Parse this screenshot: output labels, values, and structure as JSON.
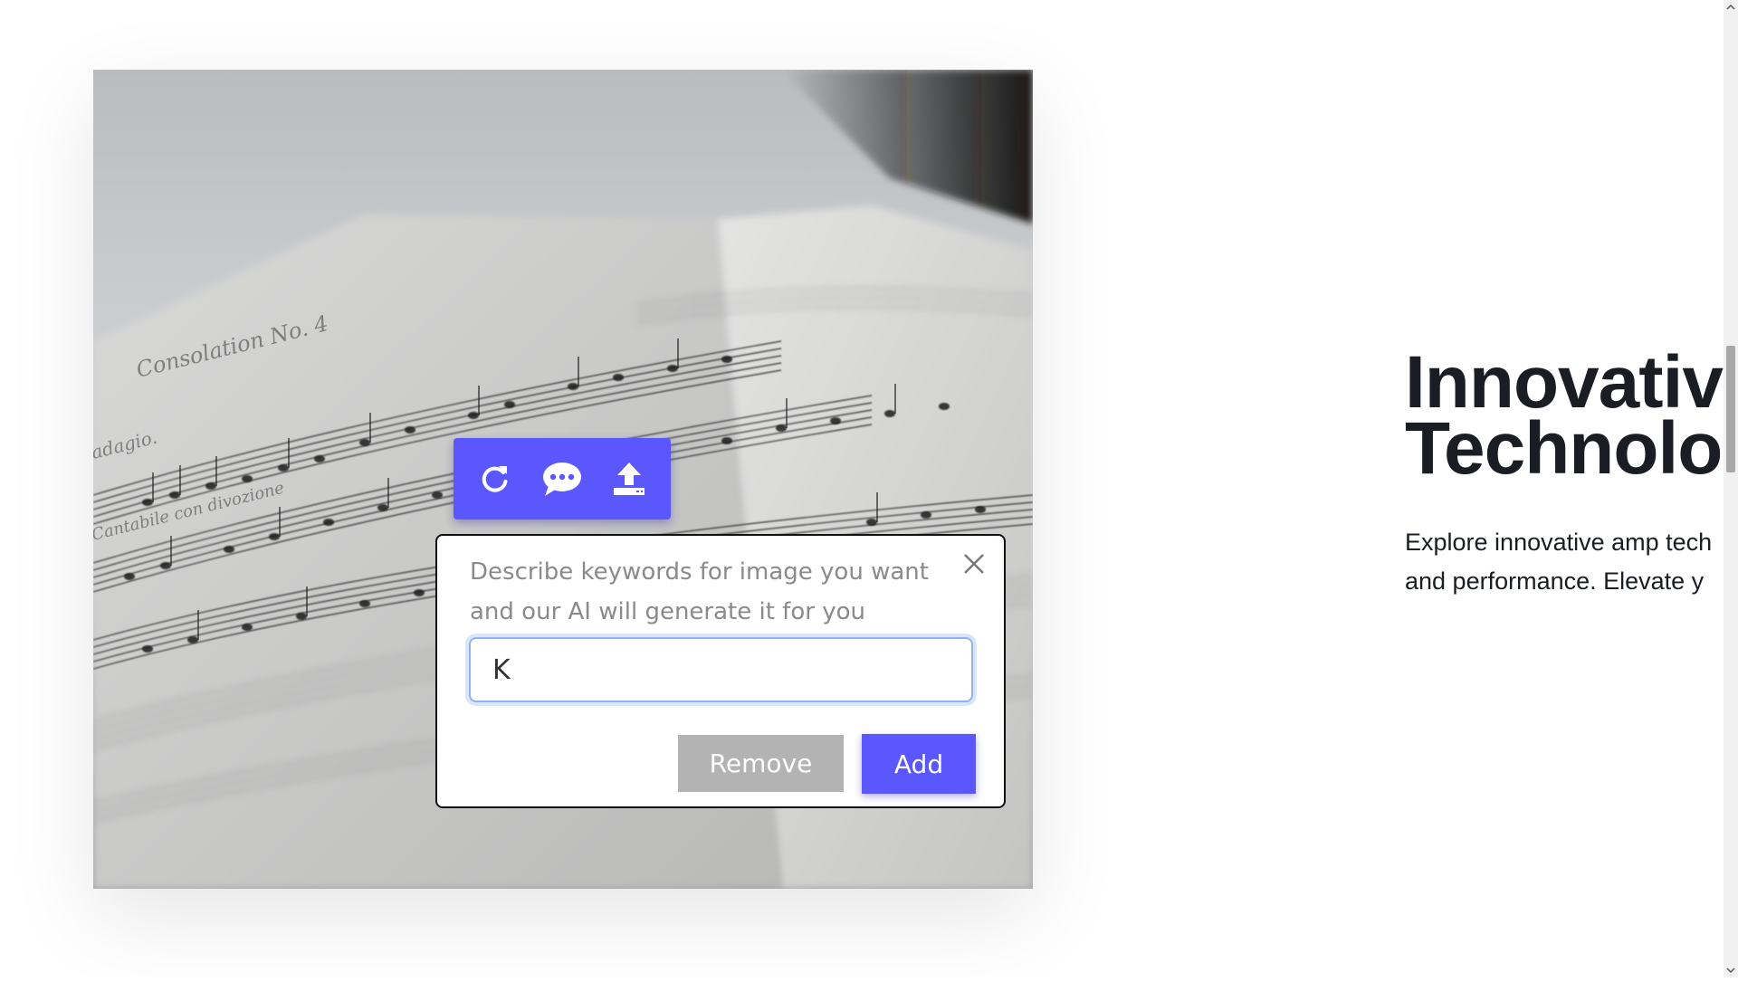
{
  "hero": {
    "title_line1": "Innovative",
    "title_line2": "Technolog",
    "desc_line1": "Explore innovative amp tech",
    "desc_line2": "and performance. Elevate y"
  },
  "toolbar": {
    "buttons": [
      {
        "icon": "refresh-icon"
      },
      {
        "icon": "chat-icon"
      },
      {
        "icon": "upload-icon"
      }
    ]
  },
  "ai_dialog": {
    "prompt": "Describe keywords for image you want and our AI will generate it for you",
    "input_value": "K",
    "remove_label": "Remove",
    "add_label": "Add",
    "close_icon": "close-icon"
  },
  "colors": {
    "accent": "#5b57ff",
    "remove_button": "#b3b3b3",
    "text_dark": "#1a1d23"
  }
}
